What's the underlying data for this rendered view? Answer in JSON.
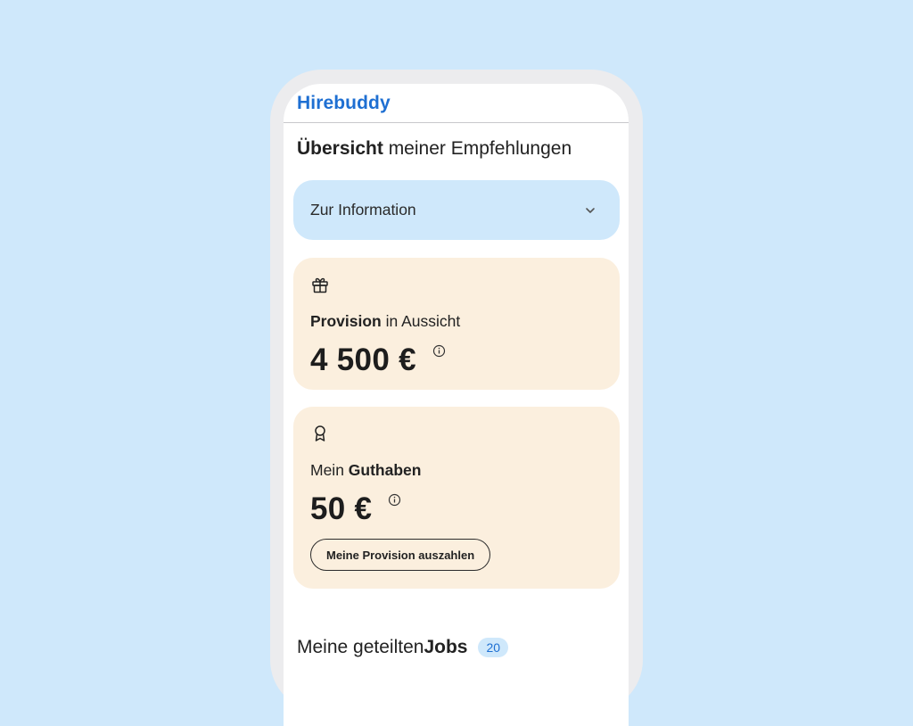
{
  "app": {
    "brand": "Hirebuddy"
  },
  "page": {
    "title_bold": "Übersicht",
    "title_rest": " meiner Empfehlungen"
  },
  "info_panel": {
    "label": "Zur Information",
    "icon": "chevron-down-icon"
  },
  "provision_card": {
    "icon": "gift-icon",
    "label_bold": "Provision",
    "label_rest": " in Aussicht",
    "amount": "4 500 €"
  },
  "credit_card": {
    "icon": "award-icon",
    "label_rest": "Mein ",
    "label_bold": "Guthaben",
    "amount": "50 €",
    "button_label": "Meine Provision auszahlen"
  },
  "jobs": {
    "title_rest": "Meine geteilten ",
    "title_bold": "Jobs",
    "count": "20"
  },
  "colors": {
    "background": "#cfe8fb",
    "brand": "#1e6fd2",
    "card": "#fbefde",
    "info_panel": "#cfe8fb"
  }
}
